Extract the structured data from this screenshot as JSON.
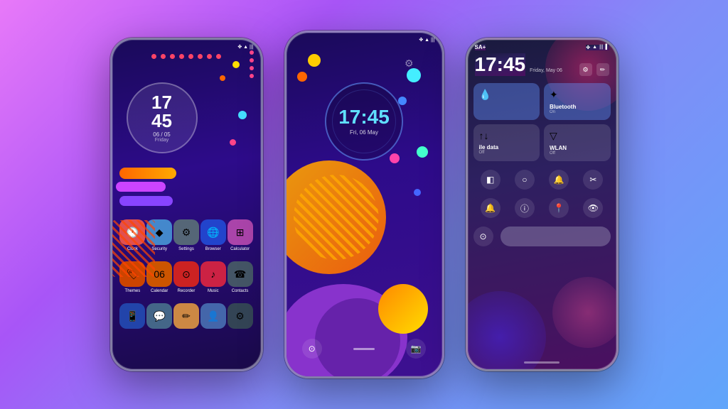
{
  "background": {
    "gradient": "linear-gradient(135deg, #e879f9, #a855f7, #818cf8, #60a5fa)"
  },
  "phone1": {
    "status_bar": "● ◑ ▲ ▮▮▮ ▌",
    "clock_time": "17",
    "clock_time2": "45",
    "clock_date": "06 / 05",
    "clock_day": "Friday",
    "apps_row1": [
      {
        "label": "Clock",
        "color": "#e05050",
        "icon": "🕐"
      },
      {
        "label": "Security",
        "color": "#4488ff",
        "icon": "◆"
      },
      {
        "label": "Settings",
        "color": "#555566",
        "icon": "⚙"
      },
      {
        "label": "Browser",
        "color": "#2244cc",
        "icon": "🌐"
      },
      {
        "label": "Calculator",
        "color": "#cc4488",
        "icon": "⊞"
      }
    ],
    "apps_row2": [
      {
        "label": "Themes",
        "color": "#cc4400",
        "icon": "🏷"
      },
      {
        "label": "Calendar",
        "color": "#cc4400",
        "icon": "06"
      },
      {
        "label": "Recorder",
        "color": "#cc2222",
        "icon": "⊙"
      },
      {
        "label": "Music",
        "color": "#cc2244",
        "icon": "♪"
      },
      {
        "label": "Contacts",
        "color": "#445566",
        "icon": "☎"
      }
    ],
    "apps_row3": [
      {
        "label": "",
        "color": "#2244aa",
        "icon": "📱"
      },
      {
        "label": "",
        "color": "#446688",
        "icon": "💬"
      },
      {
        "label": "",
        "color": "#cc8844",
        "icon": "✏"
      },
      {
        "label": "",
        "color": "#4466aa",
        "icon": "👤"
      },
      {
        "label": "",
        "color": "#334455",
        "icon": "⚙"
      }
    ]
  },
  "phone2": {
    "status_icons": "✦ ▲ ▮▮▮ ▌",
    "clock_time": "17:45",
    "clock_date": "Fri, 06 May",
    "bottom_icons": [
      "⊙",
      "⌂",
      "📷"
    ]
  },
  "phone3": {
    "status_left": "SA+",
    "status_icons": "✦ ⊙ ▮▮▮ ▌",
    "main_time": "17:45",
    "date_line": "Friday, May 06",
    "controls": [
      {
        "label": "",
        "sublabel": "",
        "icon": "💧",
        "active": true
      },
      {
        "label": "Bluetooth",
        "sublabel": "On",
        "icon": "✦",
        "active": true
      },
      {
        "label": "ile data",
        "sublabel": "Off",
        "icon": "↑↓",
        "active": false
      },
      {
        "label": "WLAN",
        "sublabel": "Off",
        "icon": "▽",
        "active": false
      }
    ],
    "icon_row1": [
      "◧",
      "○",
      "🔔",
      "✂"
    ],
    "icon_row2": [
      "🔔",
      "ⓘ",
      "📍",
      "👁"
    ],
    "icon_row3": [
      "⊙",
      ""
    ]
  }
}
